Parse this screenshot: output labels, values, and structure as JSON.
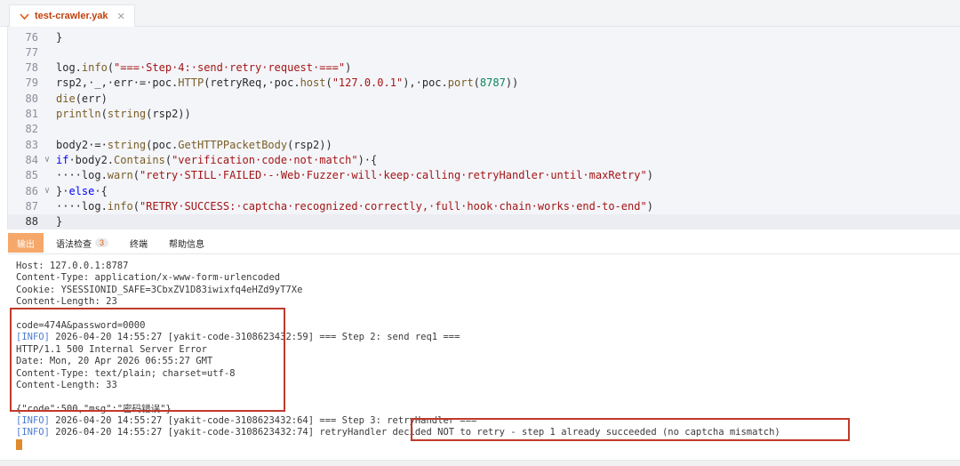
{
  "tab": {
    "filename": "test-crawler.yak",
    "icon": "yak-file-icon",
    "close": "✕"
  },
  "editor": {
    "lines": [
      {
        "no": "76",
        "fold": "",
        "parts": [
          [
            "p",
            "}"
          ]
        ]
      },
      {
        "no": "77",
        "fold": "",
        "parts": []
      },
      {
        "no": "78",
        "fold": "",
        "parts": [
          [
            "p",
            "log."
          ],
          [
            "fn",
            "info"
          ],
          [
            "p",
            "("
          ],
          [
            "str",
            "\"===·Step·4:·send·retry·request·===\""
          ],
          [
            "p",
            ")"
          ]
        ]
      },
      {
        "no": "79",
        "fold": "",
        "parts": [
          [
            "p",
            "rsp2,·_,·err·=·poc."
          ],
          [
            "fn",
            "HTTP"
          ],
          [
            "p",
            "(retryReq,·poc."
          ],
          [
            "fn",
            "host"
          ],
          [
            "p",
            "("
          ],
          [
            "str",
            "\"127.0.0.1\""
          ],
          [
            "p",
            "),·poc."
          ],
          [
            "fn",
            "port"
          ],
          [
            "p",
            "("
          ],
          [
            "num",
            "8787"
          ],
          [
            "p",
            "))"
          ]
        ]
      },
      {
        "no": "80",
        "fold": "",
        "parts": [
          [
            "fn",
            "die"
          ],
          [
            "p",
            "(err)"
          ]
        ]
      },
      {
        "no": "81",
        "fold": "",
        "parts": [
          [
            "fn",
            "println"
          ],
          [
            "p",
            "("
          ],
          [
            "fn",
            "string"
          ],
          [
            "p",
            "(rsp2))"
          ]
        ]
      },
      {
        "no": "82",
        "fold": "",
        "parts": []
      },
      {
        "no": "83",
        "fold": "",
        "parts": [
          [
            "p",
            "body2·=·"
          ],
          [
            "fn",
            "string"
          ],
          [
            "p",
            "(poc."
          ],
          [
            "fn",
            "GetHTTPPacketBody"
          ],
          [
            "p",
            "(rsp2))"
          ]
        ]
      },
      {
        "no": "84",
        "fold": "∨",
        "parts": [
          [
            "kw",
            "if"
          ],
          [
            "p",
            "·body2."
          ],
          [
            "fn",
            "Contains"
          ],
          [
            "p",
            "("
          ],
          [
            "str",
            "\"verification·code·not·match\""
          ],
          [
            "p",
            ")·{"
          ]
        ]
      },
      {
        "no": "85",
        "fold": "",
        "parts": [
          [
            "p",
            "····log."
          ],
          [
            "fn",
            "warn"
          ],
          [
            "p",
            "("
          ],
          [
            "str",
            "\"retry·STILL·FAILED·-·Web·Fuzzer·will·keep·calling·retryHandler·until·maxRetry\""
          ],
          [
            "p",
            ")"
          ]
        ]
      },
      {
        "no": "86",
        "fold": "∨",
        "parts": [
          [
            "p",
            "}·"
          ],
          [
            "kw",
            "else"
          ],
          [
            "p",
            "·{"
          ]
        ]
      },
      {
        "no": "87",
        "fold": "",
        "parts": [
          [
            "p",
            "····log."
          ],
          [
            "fn",
            "info"
          ],
          [
            "p",
            "("
          ],
          [
            "str",
            "\"RETRY·SUCCESS:·captcha·recognized·correctly,·full·hook·chain·works·end-to-end\""
          ],
          [
            "p",
            ")"
          ]
        ]
      },
      {
        "no": "88",
        "fold": "",
        "parts": [
          [
            "p",
            "}"
          ]
        ],
        "active": true
      }
    ]
  },
  "panel": {
    "tabs": [
      {
        "label": "输出",
        "active": true
      },
      {
        "label": "语法检查",
        "badge": "3"
      },
      {
        "label": "终端"
      },
      {
        "label": "帮助信息"
      }
    ]
  },
  "output": {
    "lines": [
      {
        "text": "Host: 127.0.0.1:8787"
      },
      {
        "text": "Content-Type: application/x-www-form-urlencoded"
      },
      {
        "text": "Cookie: YSESSIONID_SAFE=3CbxZV1D83iwixfq4eHZd9yT7Xe"
      },
      {
        "text": "Content-Length: 23"
      },
      {
        "text": ""
      },
      {
        "text": "code=474A&password=0000"
      },
      {
        "tag": "[INFO]",
        "text": " 2026-04-20 14:55:27 [yakit-code-3108623432:59] === Step 2: send req1 ==="
      },
      {
        "text": "HTTP/1.1 500 Internal Server Error"
      },
      {
        "text": "Date: Mon, 20 Apr 2026 06:55:27 GMT"
      },
      {
        "text": "Content-Type: text/plain; charset=utf-8"
      },
      {
        "text": "Content-Length: 33"
      },
      {
        "text": ""
      },
      {
        "text": "{\"code\":500,\"msg\":\"密码错误\"}"
      },
      {
        "tag": "[INFO]",
        "text": " 2026-04-20 14:55:27 [yakit-code-3108623432:64] === Step 3: retryHandler ==="
      },
      {
        "tag": "[INFO]",
        "text": " 2026-04-20 14:55:27 [yakit-code-3108623432:74] retryHandler decided NOT to retry - step 1 already succeeded (no captcha mismatch)"
      }
    ]
  },
  "colors": {
    "accent": "#f6a86a",
    "highlight_box": "#c0392b",
    "info": "#4b7bd3"
  }
}
